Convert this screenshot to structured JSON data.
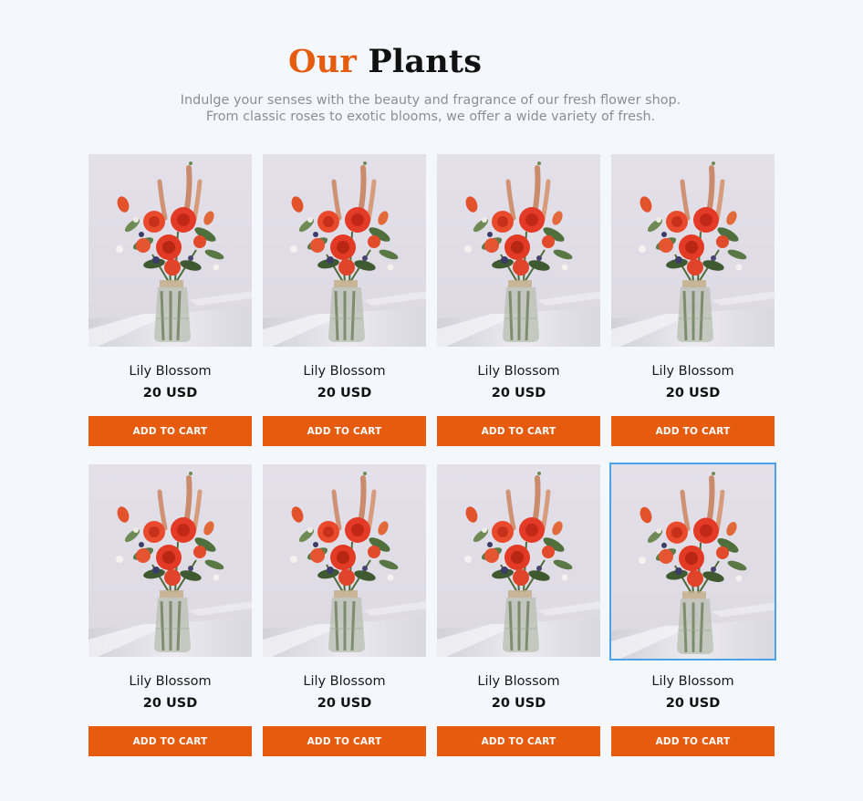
{
  "header": {
    "title_accent": "Our",
    "title_rest": "Plants",
    "subtitle": "Indulge your senses with the beauty and fragrance of our fresh flower shop. From classic roses to exotic blooms, we offer a wide variety of fresh."
  },
  "colors": {
    "accent": "#e65c0f",
    "button": "#e75b0e",
    "background": "#f4f7fd",
    "focus_outline": "#4aa3ea"
  },
  "products": [
    {
      "name": "Lily Blossom",
      "price": "20 USD",
      "button_label": "ADD TO CART",
      "image": "flower-bouquet-in-glass-vase"
    },
    {
      "name": "Lily Blossom",
      "price": "20 USD",
      "button_label": "ADD TO CART",
      "image": "flower-bouquet-in-glass-vase"
    },
    {
      "name": "Lily Blossom",
      "price": "20 USD",
      "button_label": "ADD TO CART",
      "image": "flower-bouquet-in-glass-vase"
    },
    {
      "name": "Lily Blossom",
      "price": "20 USD",
      "button_label": "ADD TO CART",
      "image": "flower-bouquet-in-glass-vase"
    },
    {
      "name": "Lily Blossom",
      "price": "20 USD",
      "button_label": "ADD TO CART",
      "image": "flower-bouquet-in-glass-vase"
    },
    {
      "name": "Lily Blossom",
      "price": "20 USD",
      "button_label": "ADD TO CART",
      "image": "flower-bouquet-in-glass-vase"
    },
    {
      "name": "Lily Blossom",
      "price": "20 USD",
      "button_label": "ADD TO CART",
      "image": "flower-bouquet-in-glass-vase"
    },
    {
      "name": "Lily Blossom",
      "price": "20 USD",
      "button_label": "ADD TO CART",
      "image": "flower-bouquet-in-glass-vase",
      "focused": true
    }
  ]
}
